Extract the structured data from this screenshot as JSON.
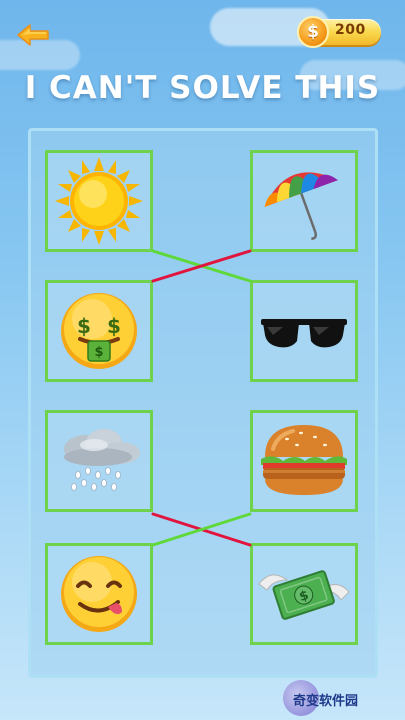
{
  "header": {
    "coins": "200",
    "coin_symbol": "$"
  },
  "title": "I CAN'T SOLVE THIS",
  "tiles": {
    "left": [
      {
        "icon": "sun-icon"
      },
      {
        "icon": "money-mouth-face-icon"
      },
      {
        "icon": "rain-cloud-icon"
      },
      {
        "icon": "savoring-face-icon"
      }
    ],
    "right": [
      {
        "icon": "rainbow-umbrella-icon"
      },
      {
        "icon": "sunglasses-icon"
      },
      {
        "icon": "hamburger-icon"
      },
      {
        "icon": "flying-money-icon"
      }
    ]
  },
  "connections": [
    {
      "from": "sun",
      "to": "sunglasses",
      "status": "correct",
      "color": "#5fd83a"
    },
    {
      "from": "money-mouth-face",
      "to": "rainbow-umbrella",
      "status": "wrong",
      "color": "#e0143c"
    },
    {
      "from": "rain-cloud",
      "to": "flying-money",
      "status": "wrong",
      "color": "#e0143c"
    },
    {
      "from": "savoring-face",
      "to": "hamburger",
      "status": "correct",
      "color": "#5fd83a"
    }
  ],
  "watermark": "奇变软件园",
  "colors": {
    "tile_border": "#6fd24c",
    "correct_line": "#5fd83a",
    "wrong_line": "#e0143c",
    "back_arrow": "#f7b21d"
  }
}
